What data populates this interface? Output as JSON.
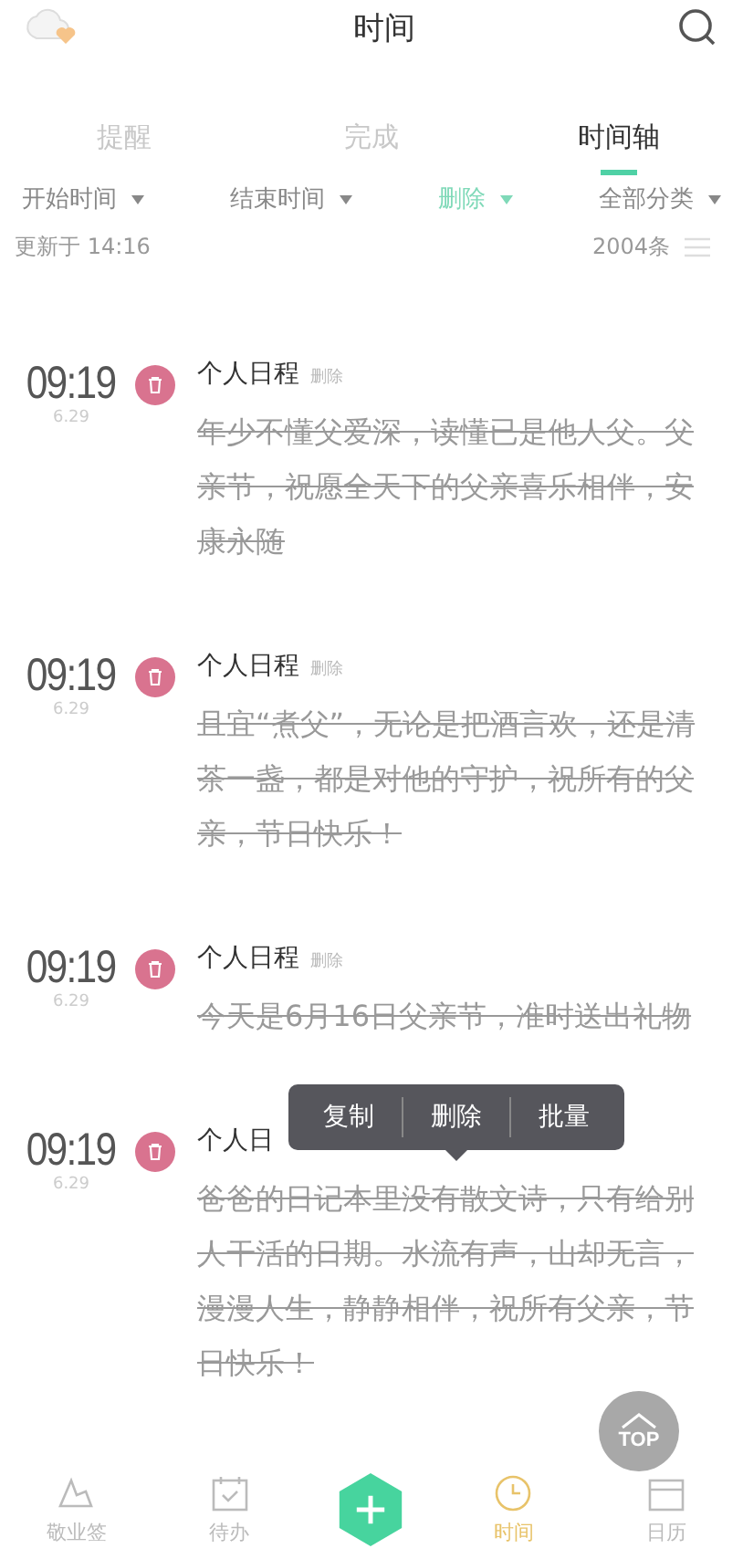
{
  "header": {
    "title": "时间"
  },
  "tabs": [
    {
      "label": "提醒",
      "selected": false
    },
    {
      "label": "完成",
      "selected": false
    },
    {
      "label": "时间轴",
      "selected": true
    }
  ],
  "filters": [
    {
      "label": "开始时间",
      "selected": false
    },
    {
      "label": "结束时间",
      "selected": false
    },
    {
      "label": "删除",
      "selected": true
    },
    {
      "label": "全部分类",
      "selected": false
    }
  ],
  "info": {
    "updated": "更新于 14:16",
    "count": "2004条"
  },
  "entries": [
    {
      "time": "09:19",
      "date": "6.29",
      "title": "个人日程",
      "tag": "删除",
      "deleted": true,
      "text": "年少不懂父爱深，读懂已是他人父。父亲节，祝愿全天下的父亲喜乐相伴，安康永随"
    },
    {
      "time": "09:19",
      "date": "6.29",
      "title": "个人日程",
      "tag": "删除",
      "deleted": true,
      "text": "且宜“煮父”，无论是把酒言欢，还是清茶一盏，都是对他的守护，祝所有的父亲，节日快乐！"
    },
    {
      "time": "09:19",
      "date": "6.29",
      "title": "个人日程",
      "tag": "删除",
      "deleted": true,
      "text": "今天是6月16日父亲节，准时送出礼物"
    },
    {
      "time": "09:19",
      "date": "6.29",
      "title": "个人日",
      "deleted": true,
      "text": "爸爸的日记本里没有散文诗，只有给别人干活的日期。水流有声，山却无言，漫漫人生，静静相伴，祝所有父亲，节日快乐！"
    }
  ],
  "context_menu": [
    "复制",
    "删除",
    "批量"
  ],
  "top_button": "TOP",
  "bottom_nav": [
    {
      "kind": "tab",
      "label": "敬业签",
      "selected": false
    },
    {
      "kind": "tab",
      "label": "待办",
      "selected": false
    },
    {
      "kind": "add"
    },
    {
      "kind": "tab",
      "label": "时间",
      "selected": true
    },
    {
      "kind": "tab",
      "label": "日历",
      "selected": false
    }
  ]
}
